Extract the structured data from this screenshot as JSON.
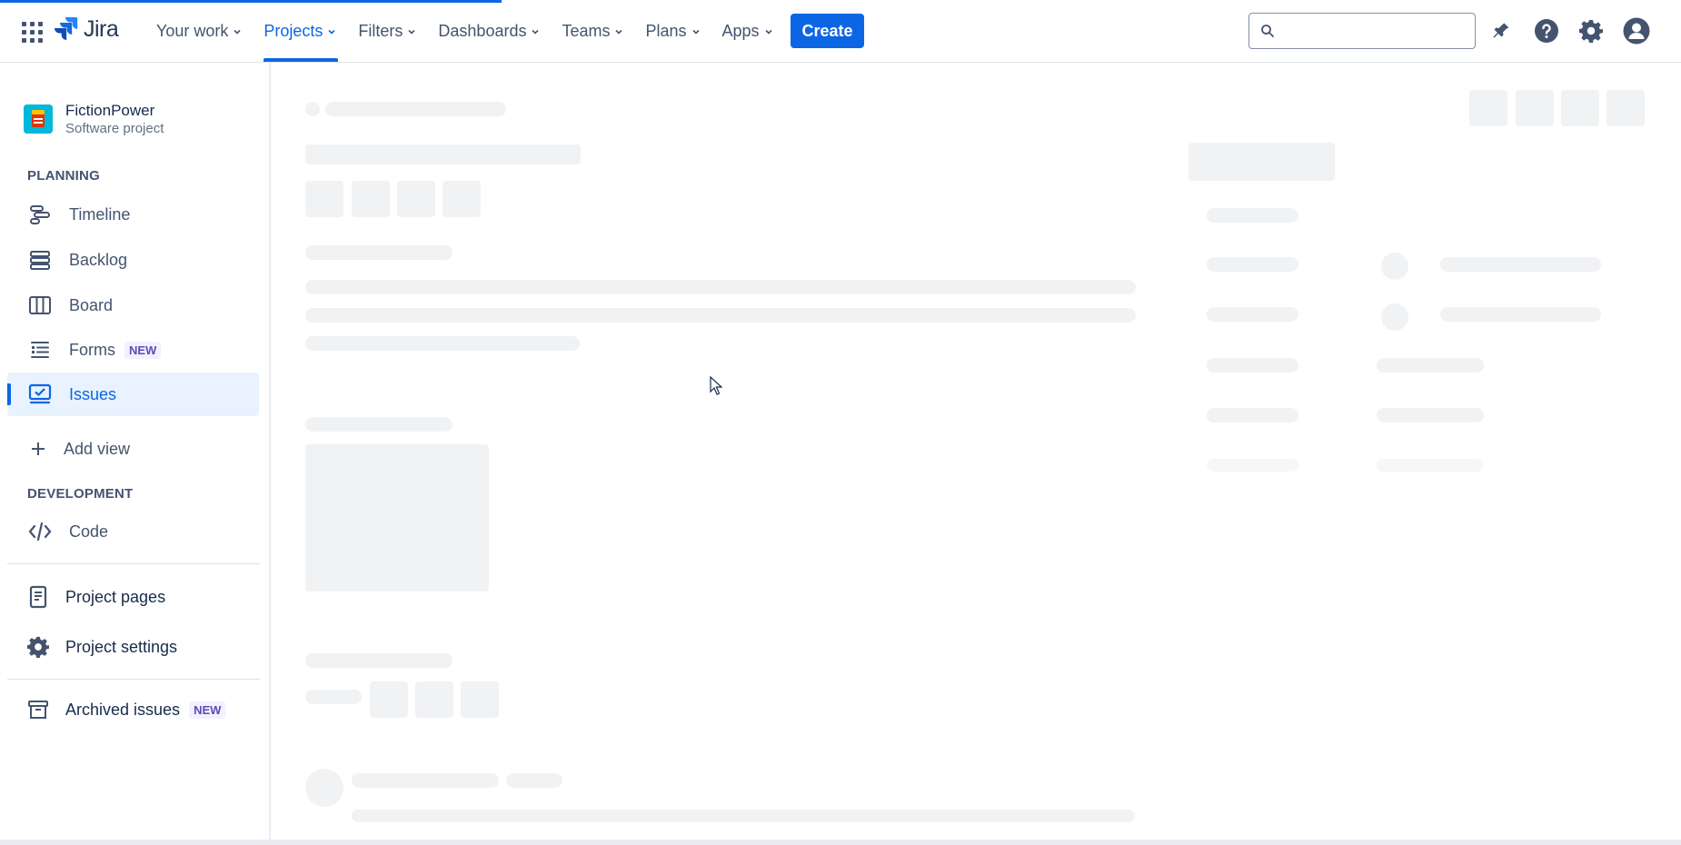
{
  "app": {
    "product_name": "Jira",
    "brand_color": "#0c66e4"
  },
  "topnav": {
    "items": [
      {
        "label": "Your work",
        "active": false
      },
      {
        "label": "Projects",
        "active": true
      },
      {
        "label": "Filters",
        "active": false
      },
      {
        "label": "Dashboards",
        "active": false
      },
      {
        "label": "Teams",
        "active": false
      },
      {
        "label": "Plans",
        "active": false
      },
      {
        "label": "Apps",
        "active": false
      }
    ],
    "create_label": "Create",
    "search_placeholder": "",
    "icons": [
      "app-switcher-icon",
      "notifications-icon",
      "help-icon",
      "settings-icon",
      "profile-icon"
    ]
  },
  "sidebar": {
    "project_name": "FictionPower",
    "project_type": "Software project",
    "planning_label": "PLANNING",
    "planning_items": [
      {
        "label": "Timeline",
        "icon": "timeline-icon"
      },
      {
        "label": "Backlog",
        "icon": "backlog-icon"
      },
      {
        "label": "Board",
        "icon": "board-icon"
      },
      {
        "label": "Forms",
        "icon": "forms-icon",
        "badge": "NEW"
      },
      {
        "label": "Issues",
        "icon": "issues-icon",
        "selected": true
      }
    ],
    "add_view_label": "Add view",
    "development_label": "DEVELOPMENT",
    "development_items": [
      {
        "label": "Code",
        "icon": "code-icon"
      }
    ],
    "project_pages_label": "Project pages",
    "project_settings_label": "Project settings",
    "archived_label": "Archived issues",
    "archived_badge": "NEW"
  }
}
